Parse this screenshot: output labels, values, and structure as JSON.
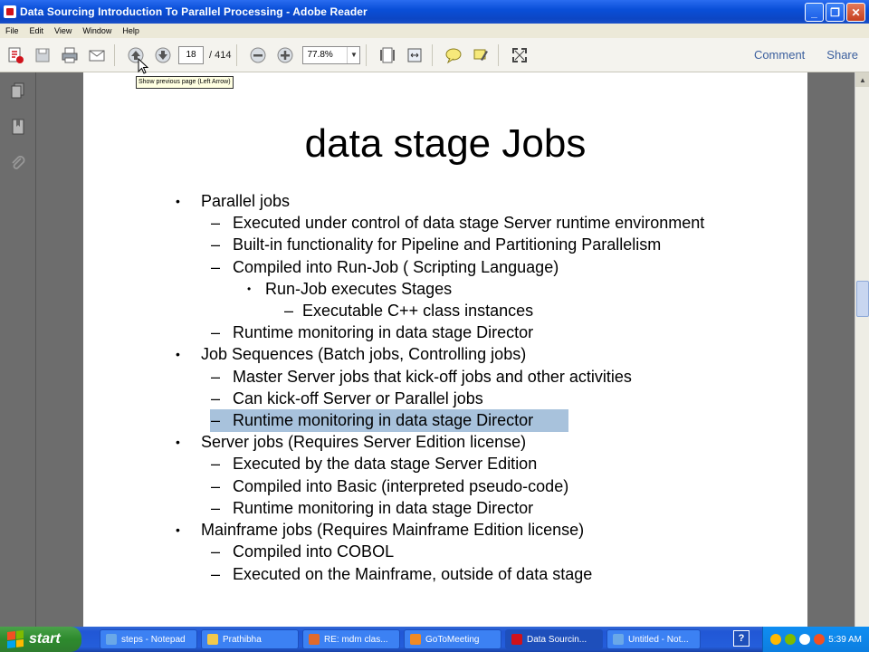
{
  "window": {
    "title": "Data Sourcing Introduction To Parallel Processing  - Adobe Reader",
    "minimize": "_",
    "maximize": "❐",
    "close": "✕"
  },
  "menu": [
    "File",
    "Edit",
    "View",
    "Window",
    "Help"
  ],
  "toolbar": {
    "page_current": "18",
    "page_total": "/ 414",
    "zoom": "77.8%",
    "comment_label": "Comment",
    "share_label": "Share"
  },
  "tooltip": "Show previous page (Left Arrow)",
  "slide": {
    "title": "data stage Jobs",
    "bullets": [
      {
        "level": 1,
        "text": "Parallel jobs"
      },
      {
        "level": 2,
        "text": "Executed under control of data stage Server runtime environment"
      },
      {
        "level": 2,
        "text": "Built-in functionality for Pipeline and Partitioning Parallelism"
      },
      {
        "level": 2,
        "text": "Compiled into Run-Job ( Scripting Language)"
      },
      {
        "level": 3,
        "text": "Run-Job executes Stages"
      },
      {
        "level": 4,
        "text": "Executable C++ class instances"
      },
      {
        "level": 2,
        "text": "Runtime monitoring in data stage Director"
      },
      {
        "level": 1,
        "text": "Job Sequences (Batch jobs, Controlling jobs)"
      },
      {
        "level": 2,
        "text": "Master Server jobs that kick-off jobs and other activities"
      },
      {
        "level": 2,
        "text": "Can kick-off Server or Parallel jobs"
      },
      {
        "level": 2,
        "text": "Runtime monitoring in data stage Director",
        "highlighted": true
      },
      {
        "level": 1,
        "text": "Server jobs (Requires Server Edition license)"
      },
      {
        "level": 2,
        "text": "Executed by the data stage Server Edition"
      },
      {
        "level": 2,
        "text": "Compiled into Basic (interpreted pseudo-code)"
      },
      {
        "level": 2,
        "text": "Runtime monitoring in data stage Director"
      },
      {
        "level": 1,
        "text": "Mainframe jobs (Requires Mainframe Edition license)"
      },
      {
        "level": 2,
        "text": "Compiled into COBOL"
      },
      {
        "level": 2,
        "text": "Executed on the Mainframe, outside of data stage"
      }
    ]
  },
  "taskbar": {
    "start_label": "start",
    "tasks": [
      {
        "label": "steps - Notepad",
        "color": "#6aa8e8"
      },
      {
        "label": "Prathibha",
        "color": "#f2c94c"
      },
      {
        "label": "RE: mdm clas...",
        "color": "#e06a2c"
      },
      {
        "label": "GoToMeeting",
        "color": "#f08a24"
      },
      {
        "label": "Data Sourcin...",
        "color": "#d0121b",
        "active": true
      },
      {
        "label": "Untitled - Not...",
        "color": "#6aa8e8"
      }
    ],
    "help": "?",
    "clock": "5:39 AM"
  },
  "colors": {
    "highlight": "#a8c2dc",
    "titlebar": "#0a4fd8",
    "link": "#3b5f9e"
  }
}
